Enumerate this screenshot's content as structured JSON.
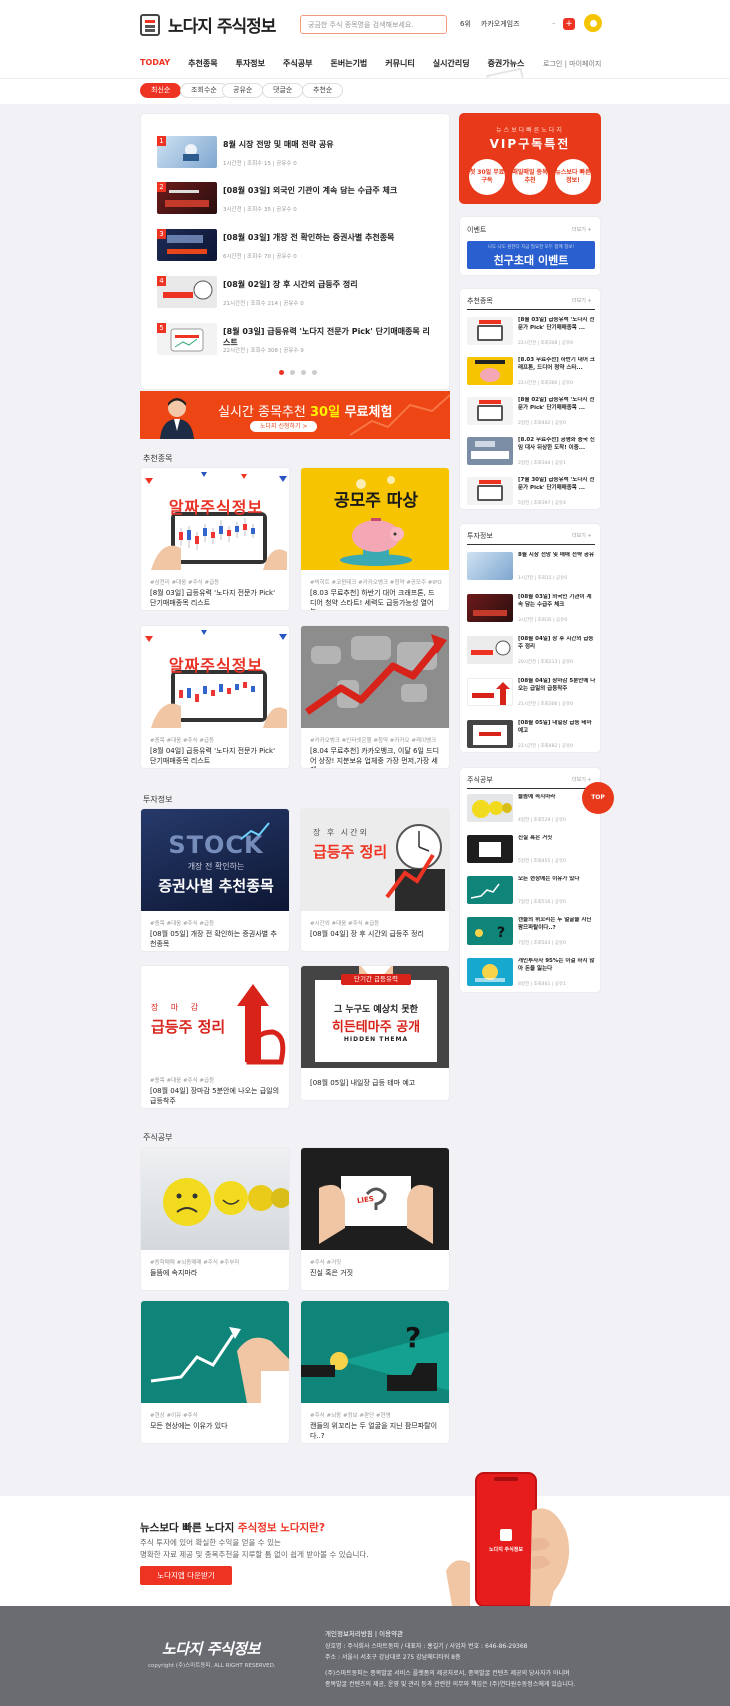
{
  "header": {
    "logo": "노다지 주식정보",
    "search_placeholder": "궁금한 주식 종목명을 검색해보세요.",
    "rank_pos": "6위",
    "rank_name": "카카오게임즈",
    "rank_dash": "–",
    "plus": "+",
    "nav": [
      "TODAY",
      "추천종목",
      "투자정보",
      "주식공부",
      "돈버는기법",
      "커뮤니티",
      "실시간리딩",
      "증권가뉴스"
    ],
    "login": "로그인",
    "sep": "|",
    "mypage": "마이페이지",
    "filters": [
      "최신순",
      "조회수순",
      "공유순",
      "댓글순",
      "추천순"
    ]
  },
  "ranking": [
    {
      "num": "1",
      "title": "8월 시장 전망 및 매매 전략 공유",
      "meta": "1시간전  |  조회수 15  |  공유수 0"
    },
    {
      "num": "2",
      "title": "[08월 03일] 외국인 기관이 계속 담는 수급주 체크",
      "meta": "3시간전  |  조회수 35  |  공유수 0"
    },
    {
      "num": "3",
      "title": "[08월 03일] 개장 전 확인하는 증권사별 추천종목",
      "meta": "6시간전  |  조회수 70  |  공유수 0"
    },
    {
      "num": "4",
      "title": "[08월 02일] 장 후 시간외 급등주 정리",
      "meta": "21시간전  |  조회수 214  |  공유수 0"
    },
    {
      "num": "5",
      "title": "[8월 03일] 급등유력 '노다지 전문가 Pick' 단기매매종목 리스트",
      "meta": "22시간전  |  조회수 308  |  공유수 9"
    }
  ],
  "banner": {
    "text1": "실시간 종목추천 ",
    "text2": "30일",
    "text3": " 무료체험",
    "button": "노다지 신청하기 >"
  },
  "sections": {
    "recommend": "추천종목",
    "invest": "투자정보",
    "study": "주식공부"
  },
  "recommend_cards": [
    {
      "tag": "#삼천리 #대웅 #주식 #급등",
      "title": "[8월 03일] 급등유력 '노다지 전문가 Pick' 단기매매종목 리스트",
      "img_text": "알짜주식정보"
    },
    {
      "tag": "#빅히트 #코윈테크 #카카오뱅크 #청약 #공모주 #IPO",
      "title": "[8.03 무료추천] 하반기 대어 크래프톤, 드디어 청약 스타트! 세력도 급등가능성 열어 놓...",
      "img_text": "공모주 따상"
    },
    {
      "tag": "#종목 #대웅 #주식 #급등",
      "title": "[8월 04일] 급등유력 '노다지 전문가 Pick' 단기매매종목 리스트",
      "img_text": "알짜주식정보"
    },
    {
      "tag": "#카카오뱅크 #인터넷은행 #청약 #카카오 #케이뱅크",
      "title": "[8.04 무료추천] 카카오뱅크, 이달 6일 드디어 상장! 지분보유 업체중 가장 먼저,가장 세게 ...",
      "img_text": ""
    }
  ],
  "invest_cards": [
    {
      "tag": "#종목 #대웅 #주식 #급등",
      "title": "[08월 05일] 개장 전 확인하는 증권사별 추천종목",
      "img_small": "개장 전 확인하는",
      "img_text": "증권사별 추천종목",
      "img_big": "STOCK"
    },
    {
      "tag": "#시간외 #대웅 #주식 #급등",
      "title": "[08월 04일] 장 후 시간외 급등주 정리",
      "img_small": "장 후 시간외",
      "img_text": "급등주 정리"
    },
    {
      "tag": "#종목 #대웅 #주식 #급등",
      "title": "[08월 04일] 장마감 5분안에 나오는 급일의 급등착주",
      "img_small": "장 마 감",
      "img_text": "급등주 정리"
    },
    {
      "tag": "",
      "title": "[08월 05일] 내일장 급등 테마 예고",
      "img_small": "단기간 급등유력",
      "img_text": "그 누구도 예상치 못한",
      "img_big": "히든테마주 공개",
      "img_sub": "HIDDEN THEMA"
    }
  ],
  "study_cards": [
    {
      "tag": "#동학매매 #뇌동매매 #주식 #주부미",
      "title": "들뜸에 속지마라"
    },
    {
      "tag": "#주식 #거짓",
      "title": "진실 혹은 거짓",
      "img_text": "LIES"
    },
    {
      "tag": "#현상 #이유 #주식",
      "title": "모든 현상에는 이유가 있다"
    },
    {
      "tag": "#주식 #뇌동 #정보 #판단 #현명",
      "title": "캔들의 위꼬리는 두 얼굴을 지닌 팜므파탈이다..?"
    }
  ],
  "sidebar": {
    "vip_small": "뉴스보다빠른노다지",
    "vip_big": "VIP구독특전",
    "vip_circles": [
      "첫 30일 무료구독",
      "매일매일 종목추천",
      "뉴스보다 빠른정보!"
    ],
    "event_head": "이벤트",
    "more": "더보기 +",
    "event_banner_small": "나도 나도 원한다 지금 필요한 모두 함께 정보!",
    "event_banner_big": "친구초대 이벤트",
    "rec_head": "추천종목",
    "rec_items": [
      {
        "title": "[8월 03일] 급등유력 '노다지 전문가 Pick' 단기매매종목 ...",
        "meta": "22시간전 | 조회308 | 공유9"
      },
      {
        "title": "[8.03 무료추천] 하반기 대어 크래프톤, 드디어 청약 스타...",
        "meta": "22시간전 | 조회366 | 공유0"
      },
      {
        "title": "[8월 02일] 급등유력 '노다지 전문가 Pick' 단기매매종목 ...",
        "meta": "2일전 | 조회402 | 공유0"
      },
      {
        "title": "[8.02 무료추천] 공평화 중국 신임 대사 뒤상한 도착! 이중...",
        "meta": "2일전 | 조회344 | 공유1"
      },
      {
        "title": "[7월 30일] 급등유력 '노다지 전문가 Pick' 단기매매종목 ...",
        "meta": "5일전 | 조회397 | 공유4"
      }
    ],
    "inv_head": "투자정보",
    "inv_items": [
      {
        "title": "8월 시장 전망 및 매매 전략 공유",
        "meta": "1시간전 | 조회15 | 공유0"
      },
      {
        "title": "[08월 03일] 외국인 기관이 계속 담는 수급주 체크",
        "meta": "3시간전 | 조회35 | 공유0"
      },
      {
        "title": "[08월 04일] 장 후 시간외 급등주 정리",
        "meta": "20시간전 | 조회213 | 공유0"
      },
      {
        "title": "[08월 04일] 장마감 5분안에 나오는 급일의 급등착주",
        "meta": "21시간전 | 조회306 | 공유0"
      },
      {
        "title": "[08월 05일] 내일장 급등 테마 예고",
        "meta": "22시간전 | 조회482 | 공유0"
      }
    ],
    "study_head": "주식공부",
    "study_items": [
      {
        "title": "들뜸에 속지마라",
        "meta": "4일전 | 조회529 | 공유0"
      },
      {
        "title": "진실 혹은 거짓",
        "meta": "5일전 | 조회455 | 공유0"
      },
      {
        "title": "모든 현상에는 이유가 있다",
        "meta": "7일전 | 조회516 | 공유0"
      },
      {
        "title": "캔들의 위꼬리는 두 얼굴을 지닌 팜므파탈이다..?",
        "meta": "7일전 | 조회503 | 공유0"
      },
      {
        "title": "개인투자자 95%는 이걸 하지 않아 돈을 잃는다",
        "meta": "8일전 | 조회461 | 공유1"
      }
    ],
    "top": "TOP"
  },
  "app": {
    "title1": "뉴스보다 빠른 노다지 ",
    "title2": "주식정보 노다지란?",
    "desc1": "주식 투자에 있어 확실한 수익을 얻을 수 있는",
    "desc2": "명확한 자료 제공 및 종목추천을 지루할 틈 없이 쉽게 받아볼 수 있습니다.",
    "button": "노다지앱 다운받기",
    "phone_logo": "노다지 주식정보"
  },
  "footer": {
    "logo": "노다지 주식정보",
    "copyright": "copyright (주)스마트동피. ALL RIGHT RESERVED.",
    "links": "개인정보처리방침   |   이용약관",
    "line1": "상호명 : 주식회사 스마트동피 / 대표자 : 홍길기 / 사업자 번호 : 646-86-29368",
    "line2": "주소 : 서울시 서초구 강남대로 275 강남메디타워 8층",
    "line3": "(주)스마트동피는 종목발굴 서비스 플랫폼의 제공자로서, 종목발굴 컨텐츠 제공의 당사자가 아니며",
    "line4": "종목발굴 컨텐츠의 제공, 운영 및 관리 등과 관련한 의무와 책임은 (주)연다원수동정스에게 있습니다."
  },
  "colors": {
    "accent": "#e32222",
    "vip": "#e8391b",
    "footer": "#6b6c72"
  }
}
